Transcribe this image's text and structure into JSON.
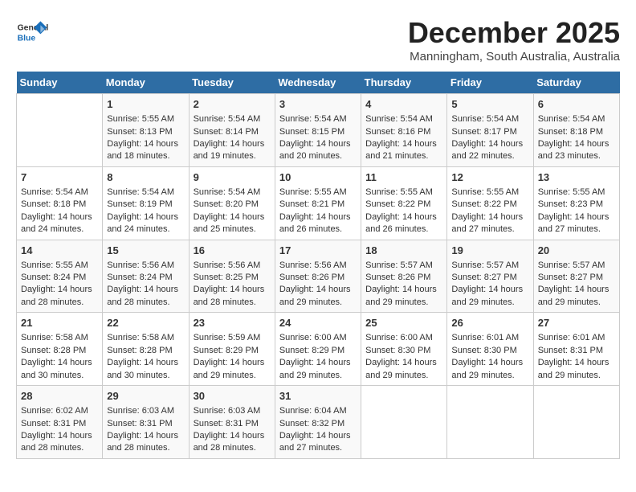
{
  "header": {
    "logo_general": "General",
    "logo_blue": "Blue",
    "month_title": "December 2025",
    "location": "Manningham, South Australia, Australia"
  },
  "days_of_week": [
    "Sunday",
    "Monday",
    "Tuesday",
    "Wednesday",
    "Thursday",
    "Friday",
    "Saturday"
  ],
  "weeks": [
    [
      {
        "day": "",
        "sunrise": "",
        "sunset": "",
        "daylight": ""
      },
      {
        "day": "1",
        "sunrise": "Sunrise: 5:55 AM",
        "sunset": "Sunset: 8:13 PM",
        "daylight": "Daylight: 14 hours and 18 minutes."
      },
      {
        "day": "2",
        "sunrise": "Sunrise: 5:54 AM",
        "sunset": "Sunset: 8:14 PM",
        "daylight": "Daylight: 14 hours and 19 minutes."
      },
      {
        "day": "3",
        "sunrise": "Sunrise: 5:54 AM",
        "sunset": "Sunset: 8:15 PM",
        "daylight": "Daylight: 14 hours and 20 minutes."
      },
      {
        "day": "4",
        "sunrise": "Sunrise: 5:54 AM",
        "sunset": "Sunset: 8:16 PM",
        "daylight": "Daylight: 14 hours and 21 minutes."
      },
      {
        "day": "5",
        "sunrise": "Sunrise: 5:54 AM",
        "sunset": "Sunset: 8:17 PM",
        "daylight": "Daylight: 14 hours and 22 minutes."
      },
      {
        "day": "6",
        "sunrise": "Sunrise: 5:54 AM",
        "sunset": "Sunset: 8:18 PM",
        "daylight": "Daylight: 14 hours and 23 minutes."
      }
    ],
    [
      {
        "day": "7",
        "sunrise": "Sunrise: 5:54 AM",
        "sunset": "Sunset: 8:18 PM",
        "daylight": "Daylight: 14 hours and 24 minutes."
      },
      {
        "day": "8",
        "sunrise": "Sunrise: 5:54 AM",
        "sunset": "Sunset: 8:19 PM",
        "daylight": "Daylight: 14 hours and 24 minutes."
      },
      {
        "day": "9",
        "sunrise": "Sunrise: 5:54 AM",
        "sunset": "Sunset: 8:20 PM",
        "daylight": "Daylight: 14 hours and 25 minutes."
      },
      {
        "day": "10",
        "sunrise": "Sunrise: 5:55 AM",
        "sunset": "Sunset: 8:21 PM",
        "daylight": "Daylight: 14 hours and 26 minutes."
      },
      {
        "day": "11",
        "sunrise": "Sunrise: 5:55 AM",
        "sunset": "Sunset: 8:22 PM",
        "daylight": "Daylight: 14 hours and 26 minutes."
      },
      {
        "day": "12",
        "sunrise": "Sunrise: 5:55 AM",
        "sunset": "Sunset: 8:22 PM",
        "daylight": "Daylight: 14 hours and 27 minutes."
      },
      {
        "day": "13",
        "sunrise": "Sunrise: 5:55 AM",
        "sunset": "Sunset: 8:23 PM",
        "daylight": "Daylight: 14 hours and 27 minutes."
      }
    ],
    [
      {
        "day": "14",
        "sunrise": "Sunrise: 5:55 AM",
        "sunset": "Sunset: 8:24 PM",
        "daylight": "Daylight: 14 hours and 28 minutes."
      },
      {
        "day": "15",
        "sunrise": "Sunrise: 5:56 AM",
        "sunset": "Sunset: 8:24 PM",
        "daylight": "Daylight: 14 hours and 28 minutes."
      },
      {
        "day": "16",
        "sunrise": "Sunrise: 5:56 AM",
        "sunset": "Sunset: 8:25 PM",
        "daylight": "Daylight: 14 hours and 28 minutes."
      },
      {
        "day": "17",
        "sunrise": "Sunrise: 5:56 AM",
        "sunset": "Sunset: 8:26 PM",
        "daylight": "Daylight: 14 hours and 29 minutes."
      },
      {
        "day": "18",
        "sunrise": "Sunrise: 5:57 AM",
        "sunset": "Sunset: 8:26 PM",
        "daylight": "Daylight: 14 hours and 29 minutes."
      },
      {
        "day": "19",
        "sunrise": "Sunrise: 5:57 AM",
        "sunset": "Sunset: 8:27 PM",
        "daylight": "Daylight: 14 hours and 29 minutes."
      },
      {
        "day": "20",
        "sunrise": "Sunrise: 5:57 AM",
        "sunset": "Sunset: 8:27 PM",
        "daylight": "Daylight: 14 hours and 29 minutes."
      }
    ],
    [
      {
        "day": "21",
        "sunrise": "Sunrise: 5:58 AM",
        "sunset": "Sunset: 8:28 PM",
        "daylight": "Daylight: 14 hours and 30 minutes."
      },
      {
        "day": "22",
        "sunrise": "Sunrise: 5:58 AM",
        "sunset": "Sunset: 8:28 PM",
        "daylight": "Daylight: 14 hours and 30 minutes."
      },
      {
        "day": "23",
        "sunrise": "Sunrise: 5:59 AM",
        "sunset": "Sunset: 8:29 PM",
        "daylight": "Daylight: 14 hours and 29 minutes."
      },
      {
        "day": "24",
        "sunrise": "Sunrise: 6:00 AM",
        "sunset": "Sunset: 8:29 PM",
        "daylight": "Daylight: 14 hours and 29 minutes."
      },
      {
        "day": "25",
        "sunrise": "Sunrise: 6:00 AM",
        "sunset": "Sunset: 8:30 PM",
        "daylight": "Daylight: 14 hours and 29 minutes."
      },
      {
        "day": "26",
        "sunrise": "Sunrise: 6:01 AM",
        "sunset": "Sunset: 8:30 PM",
        "daylight": "Daylight: 14 hours and 29 minutes."
      },
      {
        "day": "27",
        "sunrise": "Sunrise: 6:01 AM",
        "sunset": "Sunset: 8:31 PM",
        "daylight": "Daylight: 14 hours and 29 minutes."
      }
    ],
    [
      {
        "day": "28",
        "sunrise": "Sunrise: 6:02 AM",
        "sunset": "Sunset: 8:31 PM",
        "daylight": "Daylight: 14 hours and 28 minutes."
      },
      {
        "day": "29",
        "sunrise": "Sunrise: 6:03 AM",
        "sunset": "Sunset: 8:31 PM",
        "daylight": "Daylight: 14 hours and 28 minutes."
      },
      {
        "day": "30",
        "sunrise": "Sunrise: 6:03 AM",
        "sunset": "Sunset: 8:31 PM",
        "daylight": "Daylight: 14 hours and 28 minutes."
      },
      {
        "day": "31",
        "sunrise": "Sunrise: 6:04 AM",
        "sunset": "Sunset: 8:32 PM",
        "daylight": "Daylight: 14 hours and 27 minutes."
      },
      {
        "day": "",
        "sunrise": "",
        "sunset": "",
        "daylight": ""
      },
      {
        "day": "",
        "sunrise": "",
        "sunset": "",
        "daylight": ""
      },
      {
        "day": "",
        "sunrise": "",
        "sunset": "",
        "daylight": ""
      }
    ]
  ]
}
